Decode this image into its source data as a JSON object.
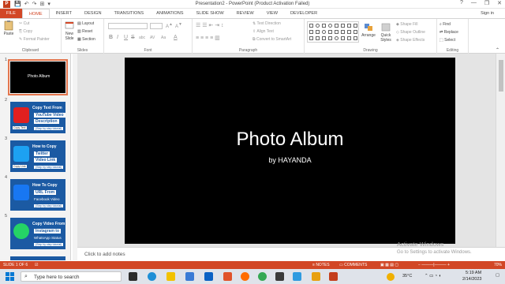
{
  "window": {
    "title": "Presentation2 - PowerPoint (Product Activation Failed)",
    "app_letter": "P",
    "controls": [
      "?",
      "—",
      "❐",
      "✕"
    ]
  },
  "qat": [
    "💾",
    "↶",
    "↷",
    "⊞",
    "▾"
  ],
  "tabs": [
    "FILE",
    "HOME",
    "INSERT",
    "DESIGN",
    "TRANSITIONS",
    "ANIMATIONS",
    "SLIDE SHOW",
    "REVIEW",
    "VIEW",
    "DEVELOPER"
  ],
  "sign_in": "Sign in",
  "ribbon": {
    "clipboard": {
      "label": "Clipboard",
      "paste": "Paste",
      "cut": "Cut",
      "copy": "Copy",
      "format_painter": "Format Painter"
    },
    "slides": {
      "label": "Slides",
      "new_slide": "New Slide",
      "layout": "Layout",
      "reset": "Reset",
      "section": "Section"
    },
    "font": {
      "label": "Font",
      "bold": "B",
      "italic": "I",
      "underline": "U",
      "strike": "S",
      "shadow": "abc",
      "spacing": "AV",
      "case": "Aa",
      "color": "A"
    },
    "paragraph": {
      "label": "Paragraph",
      "text_direction": "Text Direction",
      "align_text": "Align Text",
      "smartart": "Convert to SmartArt"
    },
    "drawing": {
      "label": "Drawing",
      "arrange": "Arrange",
      "quick_styles": "Quick Styles",
      "shape_fill": "Shape Fill",
      "shape_outline": "Shape Outline",
      "shape_effects": "Shape Effects"
    },
    "editing": {
      "label": "Editing",
      "find": "Find",
      "replace": "Replace",
      "select": "Select"
    }
  },
  "thumbnails": [
    {
      "num": "1",
      "title": "Photo Album"
    },
    {
      "num": "2",
      "line1": "Copy Text From",
      "line2": "YouTube Video",
      "line3": "Description",
      "line4": "(Step by step tutorial)",
      "label": "Copy Text",
      "icon_color": "#e02020"
    },
    {
      "num": "3",
      "line1": "How to Copy",
      "line2": "Twitter",
      "line3": "Video Link",
      "line4": "(Step by step tutorial)",
      "label": "Copy Link",
      "icon_color": "#1da1f2"
    },
    {
      "num": "4",
      "line1": "How To Copy",
      "line2": "URL From",
      "line3": "Facebook Video",
      "line4": "(Step by step tutorial)",
      "label": "",
      "icon_color": "#1877f2"
    },
    {
      "num": "5",
      "line1": "Copy Video From",
      "line2": "Instagram to",
      "line3": "WhatsApp Status",
      "line4": "(Step by step tutorial)",
      "label": "",
      "icon_color": "#25d366"
    }
  ],
  "slide": {
    "title": "Photo Album",
    "subtitle": "by HAYANDA"
  },
  "notes_placeholder": "Click to add notes",
  "activation": {
    "line1": "Activate Windows",
    "line2": "Go to Settings to activate Windows."
  },
  "status": {
    "slide": "SLIDE 1 OF 6",
    "notes": "NOTES",
    "comments": "COMMENTS",
    "zoom": "70%"
  },
  "taskbar": {
    "search_placeholder": "Type here to search",
    "temp": "35°C",
    "time": "5:19 AM",
    "date": "2/14/2023"
  },
  "colors": {
    "accent": "#d24726",
    "slide_bg": "#000000",
    "thumb_bg": "#1b5aa3"
  }
}
